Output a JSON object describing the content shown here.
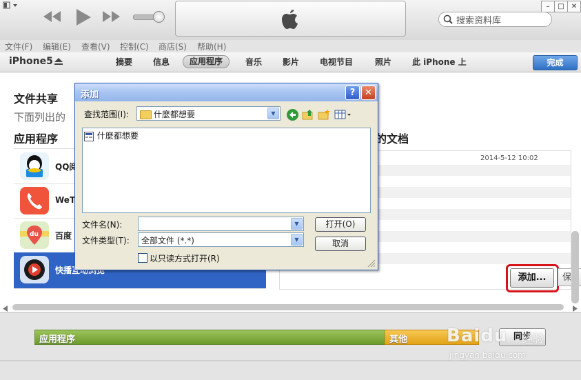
{
  "menu": [
    "文件(F)",
    "编辑(E)",
    "查看(V)",
    "控制(C)",
    "商店(S)",
    "帮助(H)"
  ],
  "search": {
    "placeholder": "搜索资料库"
  },
  "device": {
    "name": "iPhone5",
    "tabs": [
      "摘要",
      "信息",
      "应用程序",
      "音乐",
      "影片",
      "电视节目",
      "照片",
      "此 iPhone 上"
    ],
    "active_tab": "应用程序",
    "done_label": "完成"
  },
  "file_sharing": {
    "title": "文件共享",
    "subtitle": "下面列出的",
    "apps_header": "应用程序",
    "docs_header": "的文档",
    "apps": [
      {
        "name": "QQ阅",
        "icon": "qq-reader-icon",
        "color": "#1a8de0"
      },
      {
        "name": "WeTa",
        "icon": "phone-icon",
        "color": "#f0543a"
      },
      {
        "name": "百度",
        "icon": "baidu-map-icon",
        "color": "#e8544a"
      },
      {
        "name": "快播互动浏览",
        "icon": "qvod-icon",
        "color": "#1b1b1b"
      }
    ],
    "doc_date": "2014-5-12 10:02",
    "add_label": "添加...",
    "save_label": "保"
  },
  "capacity": {
    "apps_label": "应用程序",
    "other_label": "其他",
    "sync_label": "同步"
  },
  "dialog": {
    "title": "添加",
    "look_in_label": "查找范围(I):",
    "look_in_value": "什麼都想要",
    "file_item": "什麼都想要",
    "filename_label": "文件名(N):",
    "filename_value": "",
    "filetype_label": "文件类型(T):",
    "filetype_value": "全部文件 (*.*)",
    "open_label": "打开(O)",
    "cancel_label": "取消",
    "readonly_label": "以只读方式打开(R)"
  },
  "watermark": {
    "brand": "Baidu",
    "sub": "经验",
    "url": "jingyan.baidu.com"
  },
  "colors": {
    "accent": "#2f63c4",
    "highlight_ring": "#d8141b",
    "apps_bar": "#7aa53a",
    "other_bar": "#eab32a"
  }
}
